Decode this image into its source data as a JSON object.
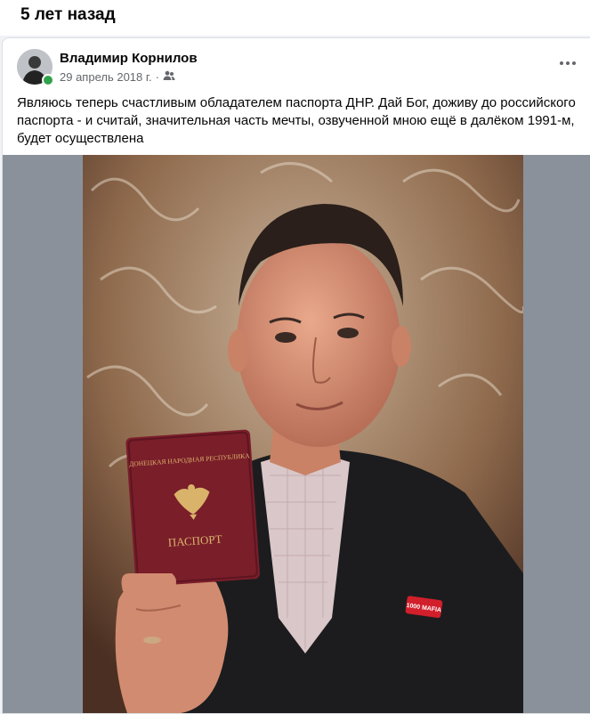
{
  "memory": {
    "title": "5 лет назад"
  },
  "post": {
    "author": "Владимир Корнилов",
    "date": "29 апрель 2018 г.",
    "separator": "·",
    "audience_icon": "friends-icon",
    "more_icon": "more-options-icon",
    "text": "Являюсь теперь счастливым обладателем паспорта ДНР. Дай Бог, доживу до российского паспорта - и считай, значительная часть мечты, озвученной мною ещё в далёком 1991-м, будет осуществлена"
  },
  "photo": {
    "passport_country": "ДОНЕЦКАЯ НАРОДНАЯ РЕСПУБЛИКА",
    "passport_word": "ПАСПОРТ",
    "badge_text": "1000 MAFIA"
  },
  "colors": {
    "online": "#31a24c",
    "background": "#f0f2f5",
    "media_bg": "#8a919b",
    "passport": "#7a1e2a"
  }
}
